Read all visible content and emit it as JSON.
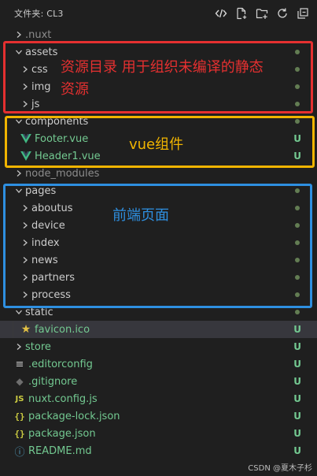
{
  "header": {
    "title": "文件夹: CL3",
    "actions": [
      {
        "name": "code-icon"
      },
      {
        "name": "new-file-icon"
      },
      {
        "name": "new-folder-icon"
      },
      {
        "name": "refresh-icon"
      },
      {
        "name": "collapse-all-icon"
      }
    ]
  },
  "tree": [
    {
      "label": ".nuxt",
      "type": "folder",
      "open": false,
      "depth": 0,
      "git": "ignored"
    },
    {
      "label": "assets",
      "type": "folder",
      "open": true,
      "depth": 0,
      "dot": true
    },
    {
      "label": "css",
      "type": "folder",
      "open": false,
      "depth": 1,
      "dot": true
    },
    {
      "label": "img",
      "type": "folder",
      "open": false,
      "depth": 1,
      "dot": true
    },
    {
      "label": "js",
      "type": "folder",
      "open": false,
      "depth": 1,
      "dot": true
    },
    {
      "label": "components",
      "type": "folder",
      "open": true,
      "depth": 0,
      "dot": true
    },
    {
      "label": "Footer.vue",
      "type": "vue",
      "depth": 1,
      "badge": "U"
    },
    {
      "label": "Header1.vue",
      "type": "vue",
      "depth": 1,
      "badge": "U"
    },
    {
      "label": "node_modules",
      "type": "folder",
      "open": false,
      "depth": 0,
      "git": "ignored"
    },
    {
      "label": "pages",
      "type": "folder",
      "open": true,
      "depth": 0,
      "dot": true
    },
    {
      "label": "aboutus",
      "type": "folder",
      "open": false,
      "depth": 1,
      "dot": true
    },
    {
      "label": "device",
      "type": "folder",
      "open": false,
      "depth": 1,
      "dot": true
    },
    {
      "label": "index",
      "type": "folder",
      "open": false,
      "depth": 1,
      "dot": true
    },
    {
      "label": "news",
      "type": "folder",
      "open": false,
      "depth": 1,
      "dot": true
    },
    {
      "label": "partners",
      "type": "folder",
      "open": false,
      "depth": 1,
      "dot": true
    },
    {
      "label": "process",
      "type": "folder",
      "open": false,
      "depth": 1,
      "dot": true
    },
    {
      "label": "static",
      "type": "folder",
      "open": true,
      "depth": 0,
      "dot": true
    },
    {
      "label": "favicon.ico",
      "type": "favicon",
      "depth": 1,
      "badge": "U",
      "active": true
    },
    {
      "label": "store",
      "type": "folder",
      "open": false,
      "depth": 0,
      "badge": "U"
    },
    {
      "label": ".editorconfig",
      "type": "config",
      "depth": 0,
      "badge": "U"
    },
    {
      "label": ".gitignore",
      "type": "git",
      "depth": 0,
      "badge": "U"
    },
    {
      "label": "nuxt.config.js",
      "type": "js",
      "depth": 0,
      "badge": "U"
    },
    {
      "label": "package-lock.json",
      "type": "json",
      "depth": 0,
      "badge": "U"
    },
    {
      "label": "package.json",
      "type": "json",
      "depth": 0,
      "badge": "U"
    },
    {
      "label": "README.md",
      "type": "info",
      "depth": 0,
      "badge": "U"
    }
  ],
  "annotations": {
    "assets_line1": "资源目录 用于组织未编译的静态",
    "assets_line2": "资源",
    "components": "vue组件",
    "pages": "前端页面"
  },
  "watermark": "CSDN @夏木子杉",
  "colors": {
    "red": "#e53030",
    "yellow": "#f0b400",
    "blue": "#2e8fe0",
    "untracked": "#73c991",
    "vue": "#41b883"
  }
}
